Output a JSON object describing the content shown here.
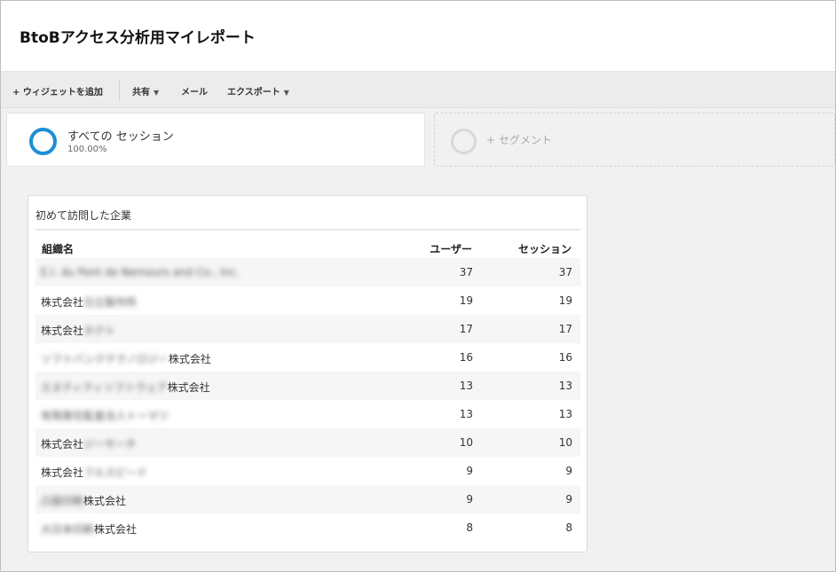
{
  "header": {
    "title": "BtoBアクセス分析用マイレポート"
  },
  "toolbar": {
    "add_widget": "+ ウィジェットを追加",
    "share": "共有",
    "email": "メール",
    "export": "エクスポート"
  },
  "segment": {
    "name": "すべての セッション",
    "percent": "100.00%",
    "add_label": "+ セグメント"
  },
  "colors": {
    "accent": "#1b8fd6"
  },
  "icons": {
    "segment": "segment-ring-icon",
    "caret": "caret-down-icon"
  },
  "widget": {
    "title": "初めて訪問した企業",
    "columns": [
      "組織名",
      "ユーザー",
      "セッション"
    ],
    "rows": [
      {
        "org_prefix": "",
        "org_blurred": "E.I. du Pont de Nemours and Co., Inc.",
        "org_suffix": "",
        "users": "37",
        "sessions": "37"
      },
      {
        "org_prefix": "株式会社",
        "org_blurred": "日立製作所",
        "org_suffix": "",
        "users": "19",
        "sessions": "19"
      },
      {
        "org_prefix": "株式会社",
        "org_blurred": "ホクト",
        "org_suffix": "",
        "users": "17",
        "sessions": "17"
      },
      {
        "org_prefix": "",
        "org_blurred": "ソフトバンクテクノロジー",
        "org_suffix": "株式会社",
        "users": "16",
        "sessions": "16"
      },
      {
        "org_prefix": "",
        "org_blurred": "エヌティティソフトウェア",
        "org_suffix": "株式会社",
        "users": "13",
        "sessions": "13"
      },
      {
        "org_prefix": "",
        "org_blurred": "有限責任監査法人トーマツ",
        "org_suffix": "",
        "users": "13",
        "sessions": "13"
      },
      {
        "org_prefix": "株式会社",
        "org_blurred": "ジーサーチ",
        "org_suffix": "",
        "users": "10",
        "sessions": "10"
      },
      {
        "org_prefix": "株式会社",
        "org_blurred": "フルスピード",
        "org_suffix": "",
        "users": "9",
        "sessions": "9"
      },
      {
        "org_prefix": "",
        "org_blurred": "凸版印刷",
        "org_suffix": "株式会社",
        "users": "9",
        "sessions": "9"
      },
      {
        "org_prefix": "",
        "org_blurred": "大日本印刷",
        "org_suffix": "株式会社",
        "users": "8",
        "sessions": "8"
      }
    ]
  }
}
